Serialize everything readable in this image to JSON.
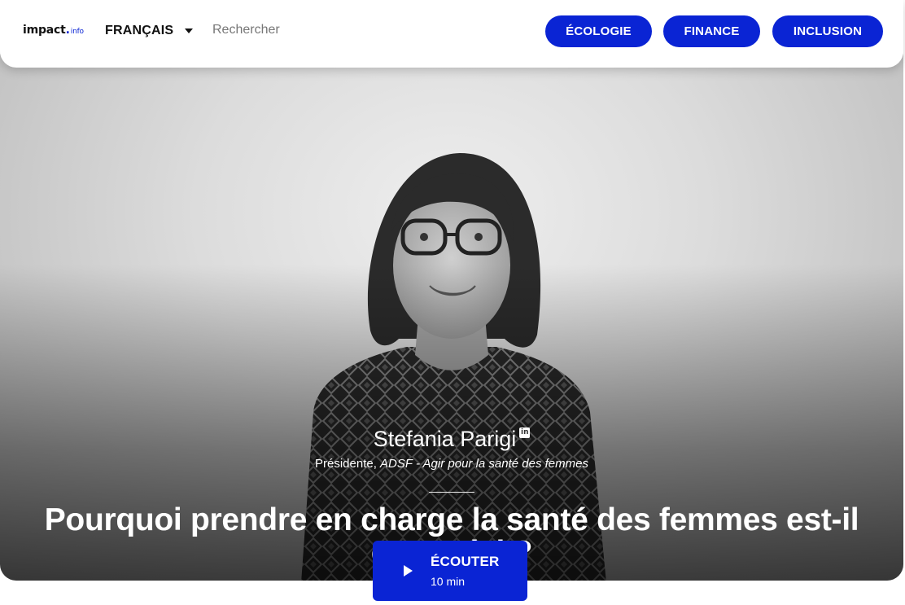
{
  "header": {
    "logo_main": "impact",
    "logo_dot": ".",
    "logo_tld": "info",
    "language": "FRANÇAIS",
    "search_placeholder": "Rechercher",
    "categories": [
      "ÉCOLOGIE",
      "FINANCE",
      "INCLUSION"
    ]
  },
  "hero": {
    "person_name": "Stefania Parigi",
    "linkedin_glyph": "in",
    "role_prefix": "Présidente, ",
    "role_org": "ADSF - Agir pour la santé des femmes",
    "title": "Pourquoi prendre en charge la santé des femmes est-il essentiel ?"
  },
  "listen": {
    "label": "ÉCOUTER",
    "duration": "10 min"
  },
  "colors": {
    "accent": "#0a24d4"
  },
  "icons": {
    "language_dropdown": "chevron-down-icon",
    "linkedin": "linkedin-icon",
    "play": "play-icon"
  }
}
